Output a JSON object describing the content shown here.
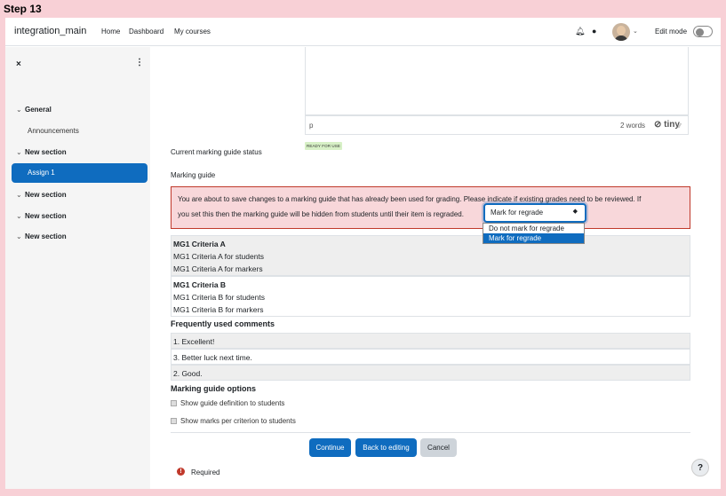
{
  "step": "Step 13",
  "navbar": {
    "brand": "integration_main",
    "links": [
      "Home",
      "Dashboard",
      "My courses"
    ],
    "edit_mode_label": "Edit mode"
  },
  "drawer": {
    "close": "×",
    "kebab": "⋮",
    "sections": [
      {
        "label": "General",
        "items": [
          "Announcements"
        ]
      },
      {
        "label": "New section",
        "items": [
          "Assign 1"
        ]
      },
      {
        "label": "New section",
        "items": []
      },
      {
        "label": "New section",
        "items": []
      },
      {
        "label": "New section",
        "items": []
      }
    ],
    "active_item": "Assign 1"
  },
  "editor": {
    "tag": "p",
    "word_count": "2 words",
    "brand": "tiny"
  },
  "status": {
    "label": "Current marking guide status",
    "badge": "READY FOR USE"
  },
  "marking_guide": {
    "label": "Marking guide",
    "alert_line1": "You are about to save changes to a marking guide that has already been used for grading. Please indicate if existing grades need to be reviewed. If",
    "alert_line2": "you set this then the marking guide will be hidden from students until their item is regraded.",
    "select_value": "Mark for regrade",
    "options": [
      "Do not mark for regrade",
      "Mark for regrade"
    ]
  },
  "criteria": [
    {
      "title": "MG1 Criteria A",
      "students": "MG1 Criteria A for students",
      "markers": "MG1 Criteria A for markers"
    },
    {
      "title": "MG1 Criteria B",
      "students": "MG1 Criteria B for students",
      "markers": "MG1 Criteria B for markers"
    }
  ],
  "comments": {
    "heading": "Frequently used comments",
    "items": [
      "1. Excellent!",
      "3. Better luck next time.",
      "2. Good."
    ]
  },
  "options": {
    "heading": "Marking guide options",
    "items": [
      "Show guide definition to students",
      "Show marks per criterion to students"
    ]
  },
  "buttons": {
    "continue": "Continue",
    "back": "Back to editing",
    "cancel": "Cancel"
  },
  "required": {
    "icon": "!",
    "label": "Required"
  },
  "help": "?"
}
